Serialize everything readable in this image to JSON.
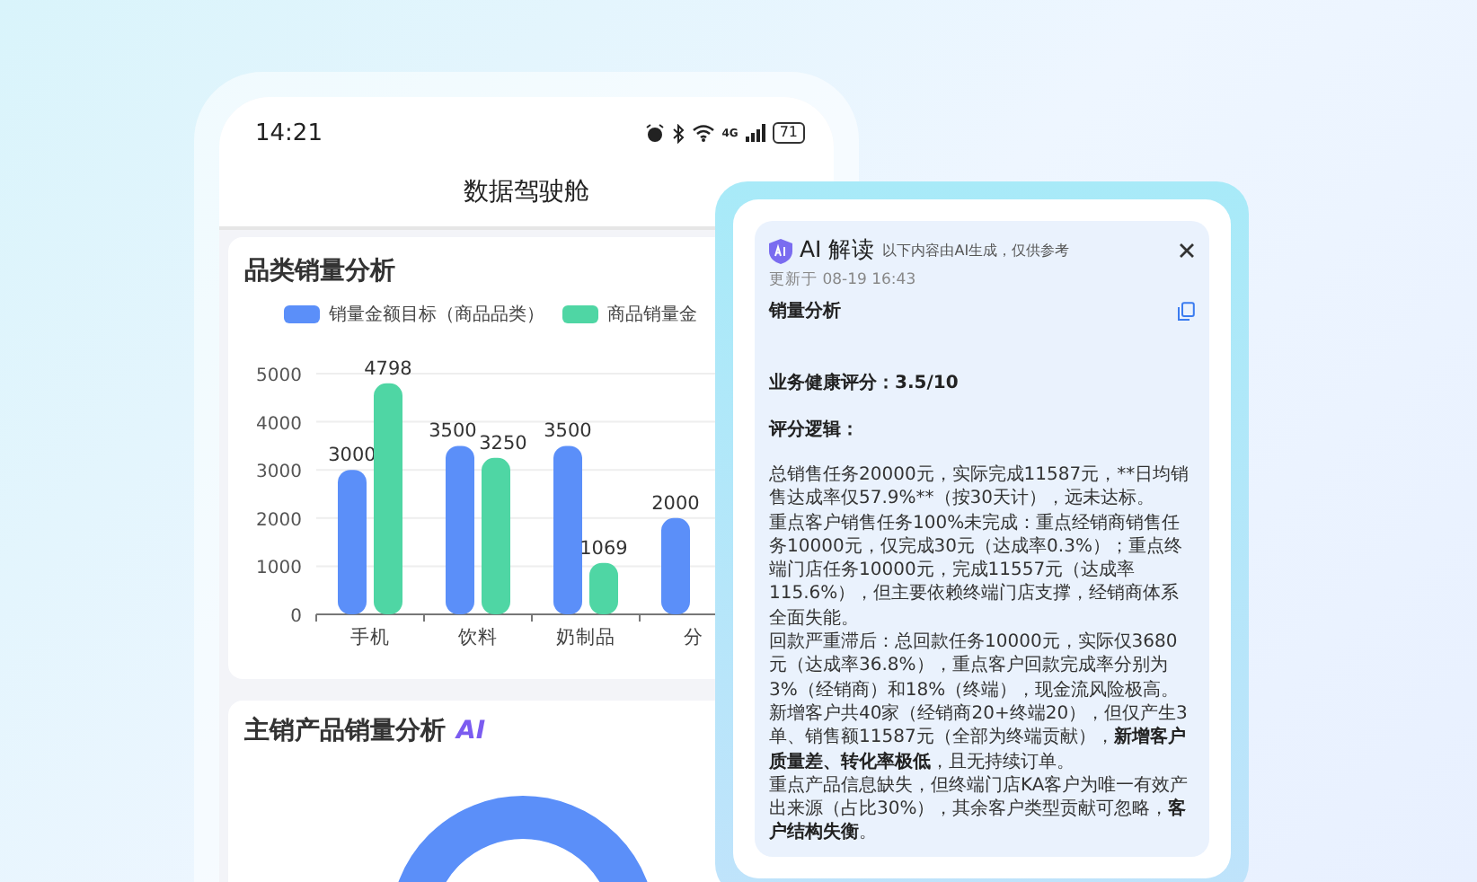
{
  "status_bar": {
    "time": "14:21",
    "network": "4G",
    "battery": "71"
  },
  "title": "数据驾驶舱",
  "category_card": {
    "title": "品类销量分析",
    "chart_data": {
      "type": "bar",
      "categories": [
        "手机",
        "饮料",
        "奶制品",
        "分"
      ],
      "ylim": [
        0,
        5000
      ],
      "yticks": [
        0,
        1000,
        2000,
        3000,
        4000,
        5000
      ],
      "data_labels": true,
      "grid": true,
      "series": [
        {
          "name": "销量金额目标（商品品类）",
          "color": "#5b8ff9",
          "values": [
            3000,
            3500,
            3500,
            2000
          ]
        },
        {
          "name": "商品销量金",
          "color": "#4fd6a4",
          "values": [
            4798,
            3250,
            1069,
            null
          ]
        }
      ]
    }
  },
  "product_card": {
    "title": "主销产品销量分析",
    "badge": "AI"
  },
  "ai_panel": {
    "title": "AI 解读",
    "subtitle": "以下内容由AI生成，仅供参考",
    "updated": "更新于 08-19 16:43",
    "section": "销量分析",
    "score": "业务健康评分：3.5/10",
    "logic_title": "评分逻辑：",
    "paragraphs": [
      {
        "text": "总销售任务20000元，实际完成11587元，**日均销售达成率仅57.9%**（按30天计），远未达标。",
        "kind": "plain"
      },
      {
        "text": "重点客户销售任务100%未完成：重点经销商销售任务10000元，仅完成30元（达成率0.3%）；重点终端门店任务10000元，完成11557元（达成率115.6%），但主要依赖终端门店支撑，经销商体系全面失能。",
        "kind": "plain"
      },
      {
        "text": "回款严重滞后：总回款任务10000元，实际仅3680元（达成率36.8%），重点客户回款完成率分别为3%（经销商）和18%（终端），现金流风险极高。",
        "kind": "plain"
      },
      {
        "text": "新增客户共40家（经销商20+终端20），但仅产生3单、销售额11587元（全部为终端贡献），**新增客户质量差、转化率极低**，且无持续订单。",
        "kind": "rich"
      },
      {
        "text": "重点产品信息缺失，但终端门店KA客户为唯一有效产出来源（占比30%），其余客户类型贡献可忽略，**客户结构失衡**。",
        "kind": "rich"
      }
    ]
  }
}
